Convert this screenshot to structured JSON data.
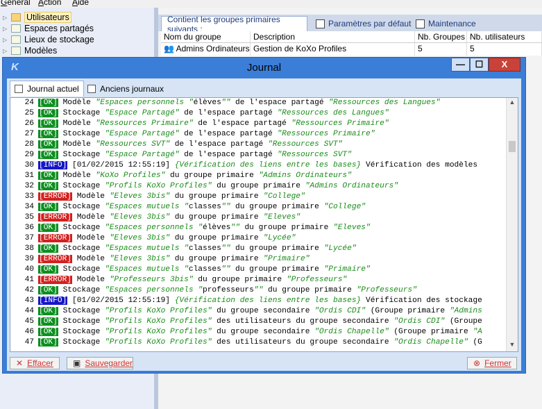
{
  "menu": [
    "Général",
    "Action",
    "Aide"
  ],
  "tree": [
    {
      "label": "Utilisateurs",
      "selected": true
    },
    {
      "label": "Espaces partagés",
      "selected": false
    },
    {
      "label": "Lieux de stockage",
      "selected": false
    },
    {
      "label": "Modèles",
      "selected": false
    }
  ],
  "tabs": [
    {
      "label": "Contient les groupes primaires suivants :"
    },
    {
      "label": "Paramètres par défaut"
    },
    {
      "label": "Maintenance"
    }
  ],
  "grid": {
    "headers": [
      "Nom du groupe",
      "Description",
      "Nb. Groupes",
      "Nb. utilisateurs"
    ],
    "rows": [
      [
        "Admins Ordinateurs",
        "Gestion de KoXo Profiles",
        "5",
        "5"
      ]
    ]
  },
  "dialog": {
    "title": "Journal",
    "logo": "K",
    "controls": {
      "minimize": "—",
      "maximize": "☐",
      "close": "X"
    },
    "subtabs": [
      "Journal actuel",
      "Anciens journaux"
    ],
    "buttons": {
      "clear": "Effacer",
      "save": "Sauvegarder",
      "close": "Fermer"
    }
  },
  "log": [
    {
      "n": "24",
      "tag": "OK",
      "parts": [
        {
          "t": " Modèle "
        },
        {
          "t": "\"Espaces personnels \"",
          "i": true
        },
        {
          "t": "élèves"
        },
        {
          "t": "\"\"",
          "i": true
        },
        {
          "t": " de l'espace partagé "
        },
        {
          "t": "\"Ressources des Langues\"",
          "i": true
        }
      ]
    },
    {
      "n": "25",
      "tag": "OK",
      "parts": [
        {
          "t": " Stockage "
        },
        {
          "t": "\"Espace Partagé\"",
          "i": true
        },
        {
          "t": " de l'espace partagé "
        },
        {
          "t": "\"Ressources des Langues\"",
          "i": true
        }
      ]
    },
    {
      "n": "26",
      "tag": "OK",
      "parts": [
        {
          "t": " Modèle "
        },
        {
          "t": "\"Ressources Primaire\"",
          "i": true
        },
        {
          "t": " de l'espace partagé "
        },
        {
          "t": "\"Ressources Primaire\"",
          "i": true
        }
      ]
    },
    {
      "n": "27",
      "tag": "OK",
      "parts": [
        {
          "t": " Stockage "
        },
        {
          "t": "\"Espace Partagé\"",
          "i": true
        },
        {
          "t": " de l'espace partagé "
        },
        {
          "t": "\"Ressources Primaire\"",
          "i": true
        }
      ]
    },
    {
      "n": "28",
      "tag": "OK",
      "parts": [
        {
          "t": " Modèle "
        },
        {
          "t": "\"Ressources SVT\"",
          "i": true
        },
        {
          "t": " de l'espace partagé "
        },
        {
          "t": "\"Ressources SVT\"",
          "i": true
        }
      ]
    },
    {
      "n": "29",
      "tag": "OK",
      "parts": [
        {
          "t": " Stockage "
        },
        {
          "t": "\"Espace Partagé\"",
          "i": true
        },
        {
          "t": " de l'espace partagé "
        },
        {
          "t": "\"Ressources SVT\"",
          "i": true
        }
      ]
    },
    {
      "n": "30",
      "tag": "INFO",
      "parts": [
        {
          "t": " [01/02/2015 12:55:19] "
        },
        {
          "t": "{Vérification des liens entre les bases}",
          "i": true
        },
        {
          "t": " Vérification des modèles"
        }
      ]
    },
    {
      "n": "31",
      "tag": "OK",
      "parts": [
        {
          "t": " Modèle "
        },
        {
          "t": "\"KoXo Profiles\"",
          "i": true
        },
        {
          "t": " du groupe primaire "
        },
        {
          "t": "\"Admins Ordinateurs\"",
          "i": true
        }
      ]
    },
    {
      "n": "32",
      "tag": "OK",
      "parts": [
        {
          "t": " Stockage "
        },
        {
          "t": "\"Profils KoXo Profiles\"",
          "i": true
        },
        {
          "t": " du groupe primaire "
        },
        {
          "t": "\"Admins Ordinateurs\"",
          "i": true
        }
      ]
    },
    {
      "n": "33",
      "tag": "ERROR",
      "parts": [
        {
          "t": " Modèle "
        },
        {
          "t": "\"Eleves 3bis\"",
          "i": true
        },
        {
          "t": " du groupe primaire "
        },
        {
          "t": "\"College\"",
          "i": true
        }
      ]
    },
    {
      "n": "34",
      "tag": "OK",
      "parts": [
        {
          "t": " Stockage "
        },
        {
          "t": "\"Espaces mutuels \"",
          "i": true
        },
        {
          "t": "classes"
        },
        {
          "t": "\"\"",
          "i": true
        },
        {
          "t": " du groupe primaire "
        },
        {
          "t": "\"College\"",
          "i": true
        }
      ]
    },
    {
      "n": "35",
      "tag": "ERROR",
      "parts": [
        {
          "t": " Modèle "
        },
        {
          "t": "\"Eleves 3bis\"",
          "i": true
        },
        {
          "t": " du groupe primaire "
        },
        {
          "t": "\"Eleves\"",
          "i": true
        }
      ]
    },
    {
      "n": "36",
      "tag": "OK",
      "parts": [
        {
          "t": " Stockage "
        },
        {
          "t": "\"Espaces personnels \"",
          "i": true
        },
        {
          "t": "élèves"
        },
        {
          "t": "\"\"",
          "i": true
        },
        {
          "t": " du groupe primaire "
        },
        {
          "t": "\"Eleves\"",
          "i": true
        }
      ]
    },
    {
      "n": "37",
      "tag": "ERROR",
      "parts": [
        {
          "t": " Modèle "
        },
        {
          "t": "\"Eleves 3bis\"",
          "i": true
        },
        {
          "t": " du groupe primaire "
        },
        {
          "t": "\"Lycée\"",
          "i": true
        }
      ]
    },
    {
      "n": "38",
      "tag": "OK",
      "parts": [
        {
          "t": " Stockage "
        },
        {
          "t": "\"Espaces mutuels \"",
          "i": true
        },
        {
          "t": "classes"
        },
        {
          "t": "\"\"",
          "i": true
        },
        {
          "t": " du groupe primaire "
        },
        {
          "t": "\"Lycée\"",
          "i": true
        }
      ]
    },
    {
      "n": "39",
      "tag": "ERROR",
      "parts": [
        {
          "t": " Modèle "
        },
        {
          "t": "\"Eleves 3bis\"",
          "i": true
        },
        {
          "t": " du groupe primaire "
        },
        {
          "t": "\"Primaire\"",
          "i": true
        }
      ]
    },
    {
      "n": "40",
      "tag": "OK",
      "parts": [
        {
          "t": " Stockage "
        },
        {
          "t": "\"Espaces mutuels \"",
          "i": true
        },
        {
          "t": "classes"
        },
        {
          "t": "\"\"",
          "i": true
        },
        {
          "t": " du groupe primaire "
        },
        {
          "t": "\"Primaire\"",
          "i": true
        }
      ]
    },
    {
      "n": "41",
      "tag": "ERROR",
      "parts": [
        {
          "t": " Modèle "
        },
        {
          "t": "\"Professeurs 3bis\"",
          "i": true
        },
        {
          "t": " du groupe primaire "
        },
        {
          "t": "\"Professeurs\"",
          "i": true
        }
      ]
    },
    {
      "n": "42",
      "tag": "OK",
      "parts": [
        {
          "t": " Stockage "
        },
        {
          "t": "\"Espaces personnels \"",
          "i": true
        },
        {
          "t": "professeurs"
        },
        {
          "t": "\"\"",
          "i": true
        },
        {
          "t": " du groupe primaire "
        },
        {
          "t": "\"Professeurs\"",
          "i": true
        }
      ]
    },
    {
      "n": "43",
      "tag": "INFO",
      "parts": [
        {
          "t": " [01/02/2015 12:55:19] "
        },
        {
          "t": "{Vérification des liens entre les bases}",
          "i": true
        },
        {
          "t": " Vérification des stockage"
        }
      ]
    },
    {
      "n": "44",
      "tag": "OK",
      "parts": [
        {
          "t": " Stockage "
        },
        {
          "t": "\"Profils KoXo Profiles\"",
          "i": true
        },
        {
          "t": " du groupe secondaire "
        },
        {
          "t": "\"Ordis CDI\"",
          "i": true
        },
        {
          "t": " (Groupe primaire "
        },
        {
          "t": "\"Admins",
          "i": true
        }
      ]
    },
    {
      "n": "45",
      "tag": "OK",
      "parts": [
        {
          "t": " Stockage "
        },
        {
          "t": "\"Profils KoXo Profiles\"",
          "i": true
        },
        {
          "t": " des utilisateurs du groupe secondaire "
        },
        {
          "t": "\"Ordis CDI\"",
          "i": true
        },
        {
          "t": " (Groupe"
        }
      ]
    },
    {
      "n": "46",
      "tag": "OK",
      "parts": [
        {
          "t": " Stockage "
        },
        {
          "t": "\"Profils KoXo Profiles\"",
          "i": true
        },
        {
          "t": " du groupe secondaire "
        },
        {
          "t": "\"Ordis Chapelle\"",
          "i": true
        },
        {
          "t": " (Groupe primaire "
        },
        {
          "t": "\"A",
          "i": true
        }
      ]
    },
    {
      "n": "47",
      "tag": "OK",
      "parts": [
        {
          "t": " Stockage "
        },
        {
          "t": "\"Profils KoXo Profiles\"",
          "i": true
        },
        {
          "t": " des utilisateurs du groupe secondaire "
        },
        {
          "t": "\"Ordis Chapelle\"",
          "i": true
        },
        {
          "t": " (G"
        }
      ]
    }
  ]
}
